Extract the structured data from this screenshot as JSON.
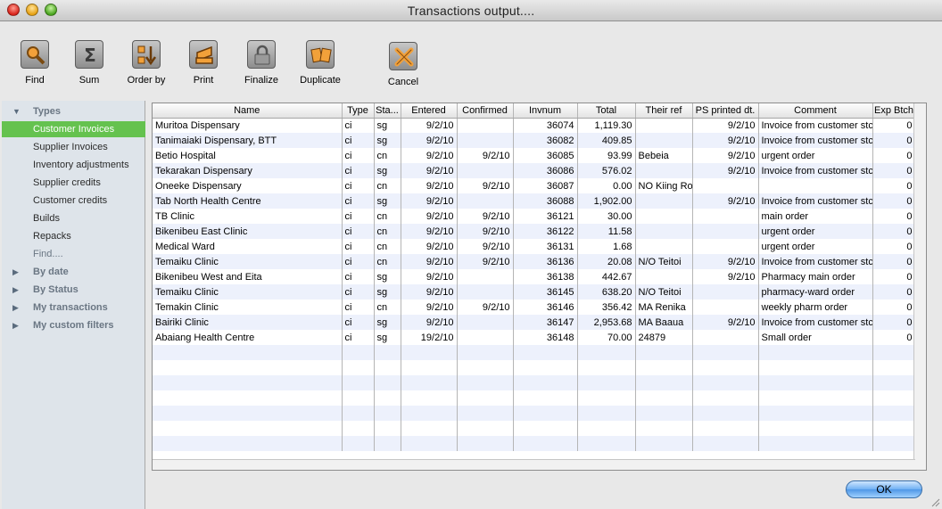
{
  "window": {
    "title": "Transactions output...."
  },
  "toolbar": {
    "find": "Find",
    "sum": "Sum",
    "order_by": "Order by",
    "print": "Print",
    "finalize": "Finalize",
    "duplicate": "Duplicate",
    "cancel": "Cancel"
  },
  "sidebar": {
    "types": "Types",
    "items": [
      "Customer Invoices",
      "Supplier Invoices",
      "Inventory adjustments",
      "Supplier credits",
      "Customer credits",
      "Builds",
      "Repacks",
      "Find...."
    ],
    "by_date": "By date",
    "by_status": "By Status",
    "my_transactions": "My transactions",
    "my_custom_filters": "My custom filters",
    "selected_color": "#65c24f"
  },
  "table": {
    "headers": [
      "Name",
      "Type",
      "Sta...",
      "Entered",
      "Confirmed",
      "Invnum",
      "Total",
      "Their ref",
      "PS printed dt.",
      "Comment",
      "Exp Btch"
    ],
    "rows": [
      [
        "Muritoa Dispensary",
        "ci",
        "sg",
        "9/2/10",
        "",
        "36074",
        "1,119.30",
        "",
        "9/2/10",
        "Invoice from customer stc",
        "0"
      ],
      [
        "Tanimaiaki Dispensary, BTT",
        "ci",
        "sg",
        "9/2/10",
        "",
        "36082",
        "409.85",
        "",
        "9/2/10",
        "Invoice from customer stc",
        "0"
      ],
      [
        "Betio Hospital",
        "ci",
        "cn",
        "9/2/10",
        "9/2/10",
        "36085",
        "93.99",
        "Bebeia",
        "9/2/10",
        "urgent order",
        "0"
      ],
      [
        "Tekarakan Dispensary",
        "ci",
        "sg",
        "9/2/10",
        "",
        "36086",
        "576.02",
        "",
        "9/2/10",
        "Invoice from customer stc",
        "0"
      ],
      [
        "Oneeke Dispensary",
        "ci",
        "cn",
        "9/2/10",
        "9/2/10",
        "36087",
        "0.00",
        "NO Kiing Rot",
        "",
        "",
        "0"
      ],
      [
        "Tab North Health Centre",
        "ci",
        "sg",
        "9/2/10",
        "",
        "36088",
        "1,902.00",
        "",
        "9/2/10",
        "Invoice from customer stc",
        "0"
      ],
      [
        "TB Clinic",
        "ci",
        "cn",
        "9/2/10",
        "9/2/10",
        "36121",
        "30.00",
        "",
        "",
        "main order",
        "0"
      ],
      [
        "Bikenibeu East Clinic",
        "ci",
        "cn",
        "9/2/10",
        "9/2/10",
        "36122",
        "11.58",
        "",
        "",
        "urgent order",
        "0"
      ],
      [
        "Medical Ward",
        "ci",
        "cn",
        "9/2/10",
        "9/2/10",
        "36131",
        "1.68",
        "",
        "",
        "urgent order",
        "0"
      ],
      [
        "Temaiku Clinic",
        "ci",
        "cn",
        "9/2/10",
        "9/2/10",
        "36136",
        "20.08",
        "N/O Teitoi",
        "9/2/10",
        "Invoice from customer stc",
        "0"
      ],
      [
        "Bikenibeu West and Eita",
        "ci",
        "sg",
        "9/2/10",
        "",
        "36138",
        "442.67",
        "",
        "9/2/10",
        "Pharmacy main order",
        "0"
      ],
      [
        "Temaiku Clinic",
        "ci",
        "sg",
        "9/2/10",
        "",
        "36145",
        "638.20",
        "N/O Teitoi",
        "",
        "pharmacy-ward order",
        "0"
      ],
      [
        "Temakin Clinic",
        "ci",
        "cn",
        "9/2/10",
        "9/2/10",
        "36146",
        "356.42",
        "MA Renika",
        "",
        "weekly pharm order",
        "0"
      ],
      [
        "Bairiki Clinic",
        "ci",
        "sg",
        "9/2/10",
        "",
        "36147",
        "2,953.68",
        "MA Baaua",
        "9/2/10",
        "Invoice from customer stc",
        "0"
      ],
      [
        "Abaiang Health Centre",
        "ci",
        "sg",
        "19/2/10",
        "",
        "36148",
        "70.00",
        "24879",
        "",
        "Small order",
        "0"
      ]
    ],
    "alt_row_color": "#edf1fc"
  },
  "footer": {
    "ok": "OK"
  }
}
